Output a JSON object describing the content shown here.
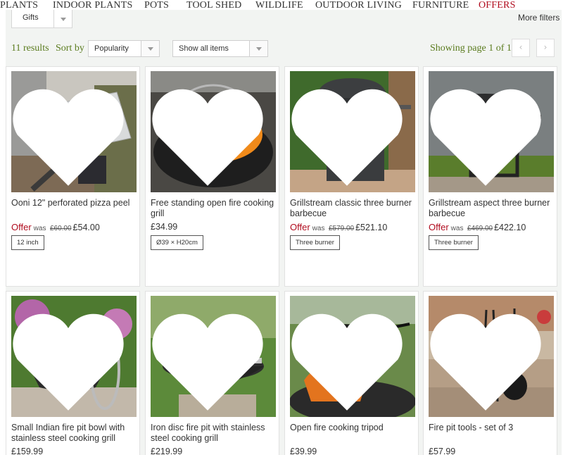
{
  "nav": {
    "items": [
      "PLANTS",
      "INDOOR PLANTS",
      "POTS",
      "TOOL SHED",
      "WILDLIFE",
      "OUTDOOR LIVING",
      "FURNITURE",
      "OFFERS"
    ]
  },
  "filters": {
    "gifts_label": "Gifts",
    "more_filters": "More filters"
  },
  "sortbar": {
    "results": "11 results",
    "sort_by": "Sort by",
    "sort_value": "Popularity",
    "show_value": "Show all items",
    "showing": "Showing page 1 of 1",
    "prev_icon": "chevron-left-icon",
    "next_icon": "chevron-right-icon"
  },
  "colors": {
    "accent_green": "#5a7b1e",
    "offer_red": "#b00b1e",
    "background": "#f2f4f2"
  },
  "products": [
    {
      "title": "Ooni 12\" perforated pizza peel",
      "offer": "Offer",
      "was_label": "was",
      "was": "£60.00",
      "price": "£54.00",
      "tag": "12 inch",
      "image": "pizza-peel"
    },
    {
      "title": "Free standing open fire cooking grill",
      "price": "£34.99",
      "tag": "Ø39 × H20cm",
      "image": "fire-grill"
    },
    {
      "title": "Grillstream classic three burner barbecue",
      "offer": "Offer",
      "was_label": "was",
      "was": "£579.00",
      "price": "£521.10",
      "tag": "Three burner",
      "image": "bbq-classic"
    },
    {
      "title": "Grillstream aspect three burner barbecue",
      "offer": "Offer",
      "was_label": "was",
      "was": "£469.00",
      "price": "£422.10",
      "tag": "Three burner",
      "image": "bbq-aspect"
    },
    {
      "title": "Small Indian fire pit bowl with stainless steel cooking grill",
      "price": "£159.99",
      "image": "fire-pit-bowl"
    },
    {
      "title": "Iron disc fire pit with stainless steel cooking grill",
      "price": "£219.99",
      "image": "iron-disc-fire-pit"
    },
    {
      "title": "Open fire cooking tripod",
      "price": "£39.99",
      "image": "cooking-tripod"
    },
    {
      "title": "Fire pit tools - set of 3",
      "price": "£57.99",
      "image": "fire-pit-tools"
    }
  ]
}
